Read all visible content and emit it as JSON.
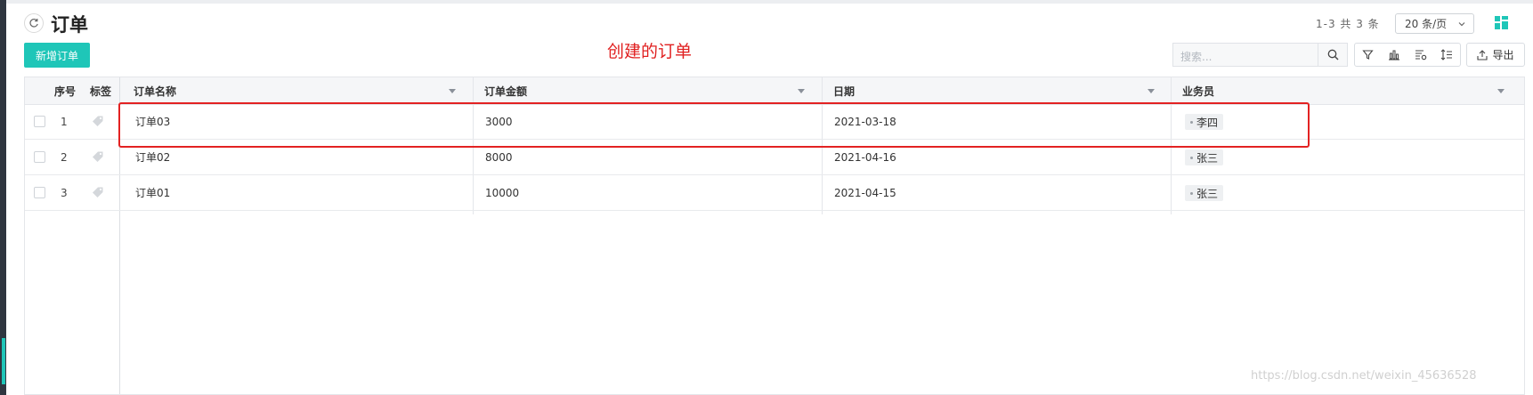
{
  "header": {
    "title": "订单",
    "count_text": "1-3 共 3 条",
    "page_size": "20 条/页"
  },
  "toolbar": {
    "add_label": "新增订单",
    "search_placeholder": "搜索...",
    "export_label": "导出"
  },
  "annotation": "创建的订单",
  "table": {
    "columns": {
      "index": "序号",
      "tag": "标签",
      "name": "订单名称",
      "amount": "订单金额",
      "date": "日期",
      "salesperson": "业务员"
    },
    "rows": [
      {
        "index": "1",
        "name": "订单03",
        "amount": "3000",
        "date": "2021-03-18",
        "salesperson": "李四"
      },
      {
        "index": "2",
        "name": "订单02",
        "amount": "8000",
        "date": "2021-04-16",
        "salesperson": "张三"
      },
      {
        "index": "3",
        "name": "订单01",
        "amount": "10000",
        "date": "2021-04-15",
        "salesperson": "张三"
      }
    ]
  },
  "watermark": "https://blog.csdn.net/weixin_45636528",
  "colors": {
    "accent": "#1fc6b8",
    "highlight": "#e32222"
  },
  "icons": [
    "refresh-icon",
    "chevron-down-icon",
    "grid-view-icon",
    "search-icon",
    "filter-icon",
    "chart-icon",
    "column-settings-icon",
    "sort-icon",
    "export-icon",
    "tag-icon"
  ]
}
